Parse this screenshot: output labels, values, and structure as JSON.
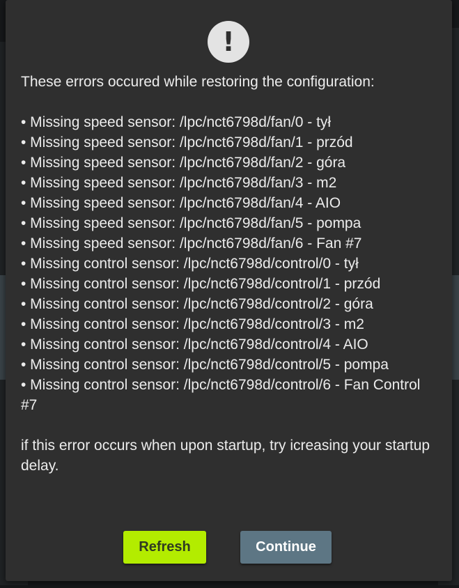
{
  "dialog": {
    "icon": "alert-exclamation-icon",
    "icon_glyph": "!",
    "heading": "These errors occured while restoring the configuration:",
    "errors": [
      "• Missing speed sensor: /lpc/nct6798d/fan/0 - tył",
      "• Missing speed sensor: /lpc/nct6798d/fan/1 - przód",
      "• Missing speed sensor: /lpc/nct6798d/fan/2 - góra",
      "• Missing speed sensor: /lpc/nct6798d/fan/3 - m2",
      "• Missing speed sensor: /lpc/nct6798d/fan/4 - AIO",
      "• Missing speed sensor: /lpc/nct6798d/fan/5 - pompa",
      "• Missing speed sensor: /lpc/nct6798d/fan/6 - Fan #7",
      "• Missing control sensor: /lpc/nct6798d/control/0 - tył",
      "• Missing control sensor: /lpc/nct6798d/control/1 - przód",
      "• Missing control sensor: /lpc/nct6798d/control/2 - góra",
      "• Missing control sensor: /lpc/nct6798d/control/3 - m2",
      "• Missing control sensor: /lpc/nct6798d/control/4 - AIO",
      "• Missing control sensor: /lpc/nct6798d/control/5 - pompa",
      "• Missing control sensor: /lpc/nct6798d/control/6 - Fan Control #7"
    ],
    "footer": "if this error occurs when upon startup, try icreasing your startup delay.",
    "buttons": {
      "refresh_label": "Refresh",
      "continue_label": "Continue"
    }
  },
  "colors": {
    "dialog_bg": "#2f2f2f",
    "text": "#ececec",
    "refresh_bg": "#b3ec00",
    "continue_bg": "#5d7684",
    "icon_bg": "#e3e3e3"
  }
}
